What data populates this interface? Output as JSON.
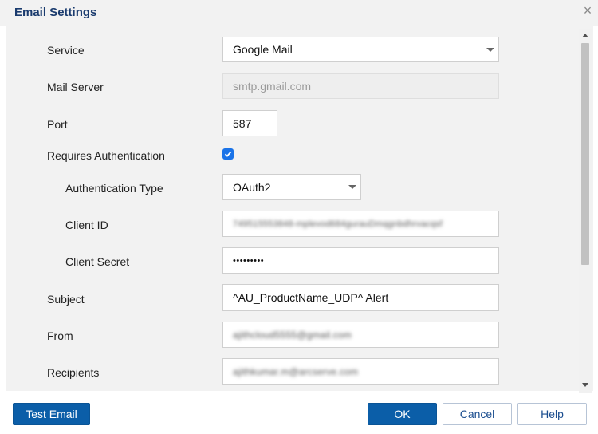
{
  "dialog": {
    "title": "Email Settings",
    "close_label": "×"
  },
  "form": {
    "service": {
      "label": "Service",
      "value": "Google Mail"
    },
    "mail_server": {
      "label": "Mail Server",
      "placeholder": "smtp.gmail.com"
    },
    "port": {
      "label": "Port",
      "value": "587"
    },
    "requires_auth": {
      "label": "Requires Authentication",
      "checked": true
    },
    "auth_type": {
      "label": "Authentication Type",
      "value": "OAuth2"
    },
    "client_id": {
      "label": "Client ID",
      "value": "749515553848-mplevod684gurauDmqgnbdhrvacqsf"
    },
    "client_secret": {
      "label": "Client Secret",
      "value": "•••••••••"
    },
    "subject": {
      "label": "Subject",
      "value": "^AU_ProductName_UDP^ Alert"
    },
    "from": {
      "label": "From",
      "value": "ajithcloud5555@gmail.com"
    },
    "recipients": {
      "label": "Recipients",
      "value": "ajithkumar.m@arcserve.com"
    }
  },
  "buttons": {
    "test_email": "Test Email",
    "ok": "OK",
    "cancel": "Cancel",
    "help": "Help"
  }
}
